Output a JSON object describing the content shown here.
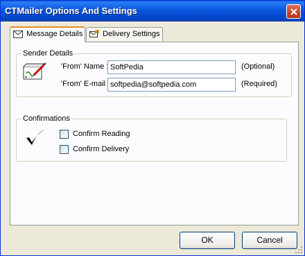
{
  "window": {
    "title": "CTMailer Options And Settings"
  },
  "tabs": [
    {
      "label": "Message Details",
      "icon": "envelope-icon",
      "active": true
    },
    {
      "label": "Delivery Settings",
      "icon": "delivery-icon",
      "active": false
    }
  ],
  "sender": {
    "group_label": "Sender Details",
    "icon": "signature-icon",
    "from_name": {
      "label": "'From' Name :",
      "value": "SoftPedia",
      "note": "(Optional)"
    },
    "from_email": {
      "label": "'From' E-mail :",
      "value": "softpedia@softpedia.com",
      "note": "(Required)"
    }
  },
  "confirmations": {
    "group_label": "Confirmations",
    "icon": "checkmark-icon",
    "items": [
      {
        "label": "Confirm Reading",
        "checked": false
      },
      {
        "label": "Confirm Delivery",
        "checked": false
      }
    ]
  },
  "buttons": {
    "ok": "OK",
    "cancel": "Cancel"
  }
}
